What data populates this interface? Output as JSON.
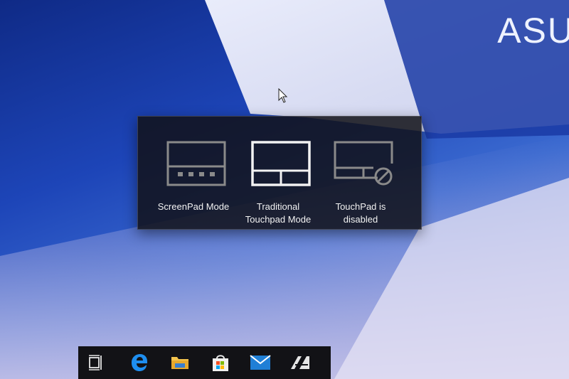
{
  "desktop": {
    "brand_text": "ASU"
  },
  "flyout": {
    "modes": [
      {
        "id": "screenpad",
        "label_line1": "ScreenPad Mode",
        "label_line2": "",
        "icon": "screenpad-mode-icon"
      },
      {
        "id": "traditional",
        "label_line1": "Traditional",
        "label_line2": "Touchpad Mode",
        "icon": "traditional-touchpad-icon"
      },
      {
        "id": "disabled",
        "label_line1": "TouchPad is",
        "label_line2": "disabled",
        "icon": "touchpad-disabled-icon"
      }
    ]
  },
  "taskbar": {
    "items": [
      {
        "name": "task-view",
        "icon": "task-view-icon"
      },
      {
        "name": "edge",
        "icon": "edge-browser-icon"
      },
      {
        "name": "file-explorer",
        "icon": "folder-icon"
      },
      {
        "name": "store",
        "icon": "store-bag-icon"
      },
      {
        "name": "mail",
        "icon": "mail-envelope-icon"
      },
      {
        "name": "screenpad-app",
        "icon": "asus-screenpad-app-icon"
      }
    ]
  },
  "colors": {
    "wallpaper_blue": "#1d45b8",
    "flyout_bg": "#121218",
    "taskbar_bg": "#121216",
    "edge_blue": "#1e8ef0",
    "folder_yellow": "#f4c44d",
    "mail_blue": "#1f7fd6"
  }
}
